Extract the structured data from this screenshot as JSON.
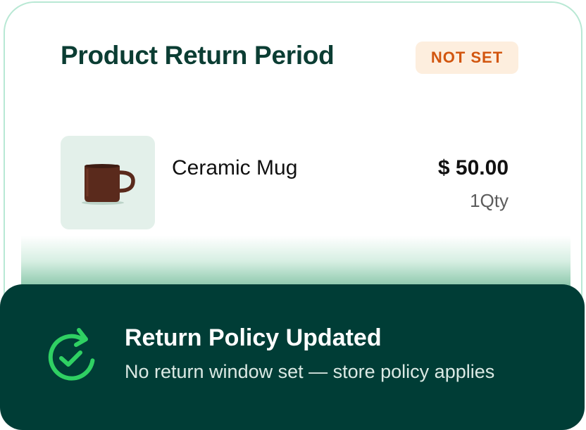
{
  "card": {
    "title": "Product Return Period",
    "status_badge": "NOT SET"
  },
  "product": {
    "name": "Ceramic Mug",
    "price": "$ 50.00",
    "quantity": "1Qty",
    "image_icon": "mug-image"
  },
  "toast": {
    "icon": "refresh-check-icon",
    "title": "Return Policy Updated",
    "message": "No return window set — store policy applies"
  },
  "colors": {
    "title_text": "#0b3d33",
    "badge_background": "#fdeede",
    "badge_text": "#d2560f",
    "toast_background": "#003d36",
    "toast_icon": "#2fd063",
    "card_border": "#b8e8d4"
  }
}
